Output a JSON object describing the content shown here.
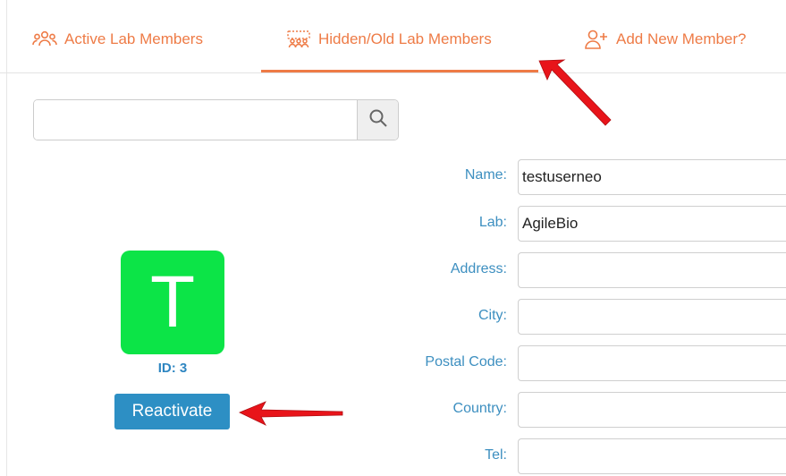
{
  "tabs": [
    {
      "label": "Active Lab Members",
      "icon": "group-icon",
      "active": false
    },
    {
      "label": "Hidden/Old Lab Members",
      "icon": "hidden-group-icon",
      "active": true
    },
    {
      "label": "Add New Member?",
      "icon": "add-user-icon",
      "active": false
    }
  ],
  "search": {
    "value": "",
    "placeholder": "",
    "icon": "search-icon"
  },
  "member": {
    "avatar_letter": "T",
    "id_text": "ID: 3",
    "reactivate_label": "Reactivate"
  },
  "form": {
    "fields": [
      {
        "label": "Name:",
        "value": "testuserneo"
      },
      {
        "label": "Lab:",
        "value": "AgileBio"
      },
      {
        "label": "Address:",
        "value": ""
      },
      {
        "label": "City:",
        "value": ""
      },
      {
        "label": "Postal Code:",
        "value": ""
      },
      {
        "label": "Country:",
        "value": ""
      },
      {
        "label": "Tel:",
        "value": ""
      }
    ]
  },
  "annotations": {
    "arrows": [
      "red-arrow-to-hidden-tab",
      "red-arrow-to-reactivate"
    ]
  },
  "colors": {
    "accent": "#ee7b46",
    "label_blue": "#3d8fc0",
    "button_blue": "#2d8fc4",
    "avatar_green": "#0ce447",
    "arrow_red": "#e8141a"
  }
}
